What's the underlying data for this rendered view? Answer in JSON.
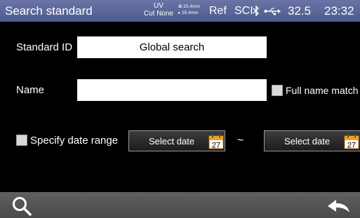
{
  "status_bar": {
    "title": "Search standard",
    "uv_label": "UV",
    "cut_label": "Cut None",
    "dim_top": "25.4mm",
    "dim_bottom": "25.4mm",
    "ref": "Ref",
    "sci": "SCI",
    "bluetooth_icon": "bluetooth-icon",
    "usb_icon": "usb-icon",
    "temperature": "32.5",
    "time": "23:32"
  },
  "form": {
    "standard_id_label": "Standard ID",
    "standard_id_value": "Global search",
    "name_label": "Name",
    "name_value": "",
    "full_name_match_label": "Full name match",
    "specify_date_range_label": "Specify date range",
    "start_date_label": "Select date",
    "end_date_label": "Select date",
    "calendar_day": "27",
    "range_separator": "~"
  },
  "bottom_bar": {
    "search_icon": "search-icon",
    "back_icon": "back-icon"
  },
  "colors": {
    "status_bar": "#5a6596",
    "background": "#000000",
    "bottom_bar": "#555555",
    "calendar_orange": "#f0a21c"
  }
}
